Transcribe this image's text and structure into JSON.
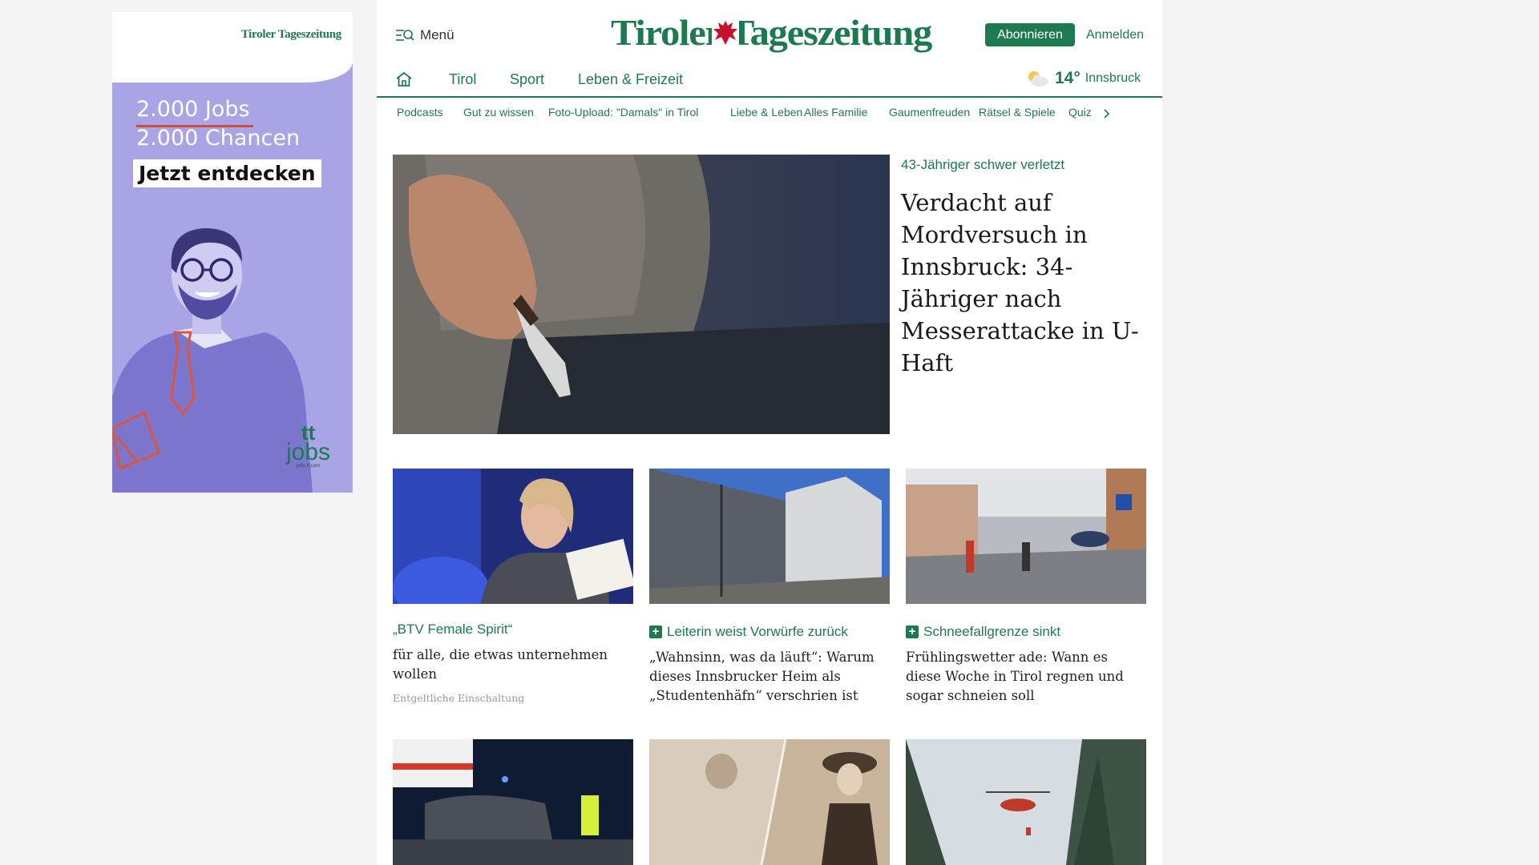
{
  "ad": {
    "brand": "Tiroler Tageszeitung",
    "line1": "2.000 Jobs",
    "line2": "2.000 Chancen",
    "cta": "Jetzt entdecken",
    "logo_top": "tt",
    "logo_bottom": "jobs",
    "domain": "jobs.tt.com"
  },
  "header": {
    "menu_label": "Menü",
    "logo_text": "Tiroler Tageszeitung",
    "subscribe_label": "Abonnieren",
    "login_label": "Anmelden"
  },
  "nav": {
    "items": [
      "Tirol",
      "Sport",
      "Leben & Freizeit"
    ]
  },
  "weather": {
    "temperature": "14°",
    "city": "Innsbruck",
    "icon": "partly-cloudy-icon"
  },
  "subnav": {
    "items": [
      "Podcasts",
      "Gut zu wissen",
      "Foto-Upload: \"Damals\" in Tirol",
      "Liebe & Leben",
      "Alles Familie",
      "Gaumenfreuden",
      "Rätsel & Spiele",
      "Quiz"
    ]
  },
  "lead": {
    "kicker": "43-Jähriger schwer verletzt",
    "title": "Verdacht auf Mordversuch in Innsbruck: 34-Jähriger nach Messerattacke in U-Haft"
  },
  "cards": [
    {
      "kicker": "„BTV Female Spirit“",
      "title": "für alle, die etwas unternehmen wollen",
      "note": "Entgeltliche Einschaltung",
      "premium": false
    },
    {
      "kicker": "Leiterin weist Vorwürfe zurück",
      "title": "„Wahnsinn, was da läuft“: Warum dieses Innsbrucker Heim als „Studentenhäfn“ verschrien ist",
      "premium": true
    },
    {
      "kicker": "Schneefallgrenze sinkt",
      "title": "Frühlingswetter ade: Wann es diese Woche in Tirol regnen und sogar schneien soll",
      "premium": true
    }
  ],
  "colors": {
    "brand_green": "#1d7a4f",
    "ad_lavender": "#a9a4e6",
    "eagle_red": "#c8102e"
  }
}
